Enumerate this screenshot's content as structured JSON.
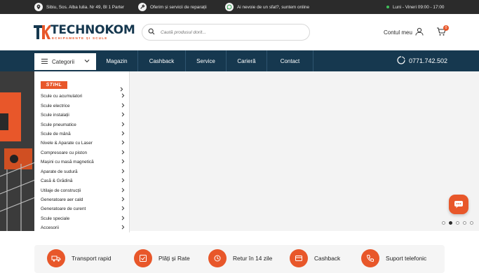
{
  "topbar": {
    "address": "Sibiu, Sos. Alba Iulia. Nr 49, Bl 1 Parter",
    "repairs": "Oferim și servicii de reparații",
    "advice": "Ai nevoie de un sfat?, suntem online",
    "hours": "Luni - Vineri 09:00 - 17:00",
    "status_color": "#3fbf5a"
  },
  "header": {
    "logo_name": "TECHNOKOM",
    "logo_tagline": "ECHIPAMENTE ȘI SCULE",
    "search_placeholder": "Caută produsul dorit...",
    "account_label": "Contul meu",
    "cart_count": "0"
  },
  "nav": {
    "categories_label": "Categorii",
    "links": [
      "Magazin",
      "Cashback",
      "Service",
      "Carieră",
      "Contact"
    ],
    "phone": "0771.742.502"
  },
  "menu": {
    "brand": "STIHL",
    "items": [
      "Scule cu acumulatori",
      "Scule electrice",
      "Scule instalații",
      "Scule pneumatice",
      "Scule de mână",
      "Nivele & Aparate cu Laser",
      "Compresoare cu piston",
      "Mașini cu masă magnetică",
      "Aparate de sudură",
      "Casă & Grădină",
      "Utilaje de construcții",
      "Generatoare aer cald",
      "Generatoare de curent",
      "Scule speciale",
      "Accesorii"
    ]
  },
  "slider": {
    "total_slides": 5,
    "active_slide": 2
  },
  "features": [
    {
      "label": "Transport rapid",
      "icon": "truck-icon"
    },
    {
      "label": "Plăți și Rate",
      "icon": "payment-icon"
    },
    {
      "label": "Retur în 14 zile",
      "icon": "return-icon"
    },
    {
      "label": "Cashback",
      "icon": "cashback-icon"
    },
    {
      "label": "Suport telefonic",
      "icon": "phone-support-icon"
    }
  ],
  "colors": {
    "brand_navy": "#16384f",
    "brand_orange": "#e8572a",
    "topbar": "#2b2b2b"
  }
}
